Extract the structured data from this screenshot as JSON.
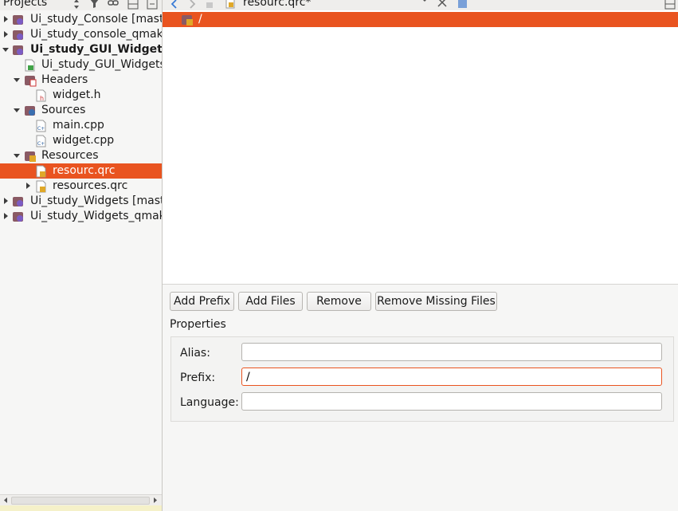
{
  "project_pane": {
    "title": "Projects",
    "tree": [
      {
        "label": "Ui_study_Console [maste",
        "expanded": false,
        "icon": "project-icon"
      },
      {
        "label": "Ui_study_console_qmake",
        "expanded": false,
        "icon": "project-icon"
      },
      {
        "label": "Ui_study_GUI_Widgets",
        "expanded": true,
        "icon": "project-icon"
      },
      {
        "label": "Ui_study_GUI_Widgets",
        "icon": "pro-file-icon"
      },
      {
        "label": "Headers",
        "expanded": true,
        "icon": "headers-folder-icon"
      },
      {
        "label": "widget.h",
        "icon": "header-file-icon"
      },
      {
        "label": "Sources",
        "expanded": true,
        "icon": "sources-folder-icon"
      },
      {
        "label": "main.cpp",
        "icon": "cpp-file-icon"
      },
      {
        "label": "widget.cpp",
        "icon": "cpp-file-icon"
      },
      {
        "label": "Resources",
        "expanded": true,
        "icon": "resources-folder-icon"
      },
      {
        "label": "resourc.qrc",
        "icon": "qrc-file-icon",
        "selected": true
      },
      {
        "label": "resources.qrc",
        "expanded": false,
        "icon": "qrc-file-icon"
      },
      {
        "label": "Ui_study_Widgets [mast",
        "expanded": false,
        "icon": "project-icon"
      },
      {
        "label": "Ui_study_Widgets_qmake",
        "expanded": false,
        "icon": "project-icon"
      }
    ]
  },
  "editor": {
    "document_title": "resourc.qrc*",
    "resource_tree": {
      "selected_prefix": "/"
    },
    "buttons": {
      "add_prefix": "Add Prefix",
      "add_files": "Add Files",
      "remove": "Remove",
      "remove_missing": "Remove Missing Files"
    },
    "properties": {
      "title": "Properties",
      "alias_label": "Alias:",
      "alias_value": "",
      "prefix_label": "Prefix:",
      "prefix_value": "/",
      "language_label": "Language:",
      "language_value": ""
    }
  },
  "colors": {
    "accent": "#E95420",
    "pane": "#F6F6F5"
  }
}
